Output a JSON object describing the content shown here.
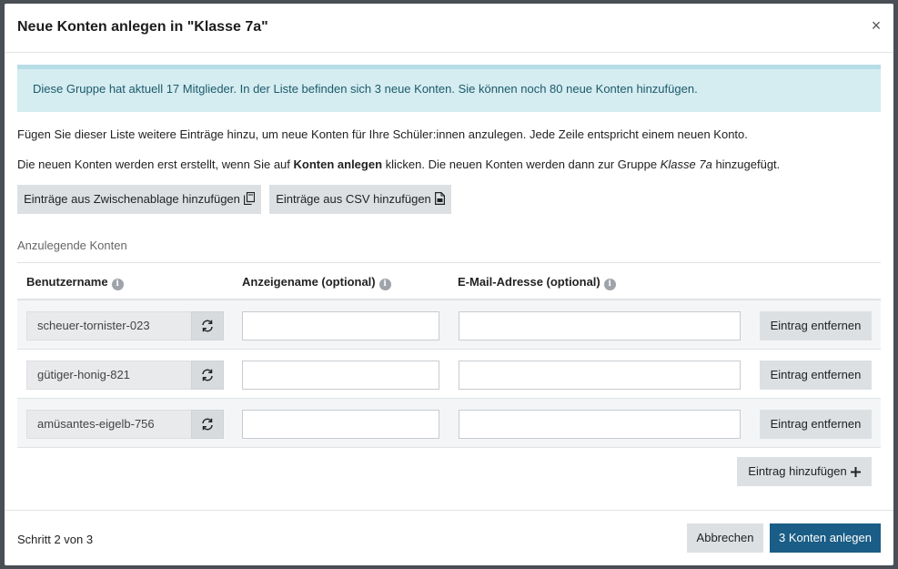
{
  "modal": {
    "title": "Neue Konten anlegen in \"Klasse 7a\"",
    "close_symbol": "×"
  },
  "alert": {
    "text": "Diese Gruppe hat aktuell 17 Mitglieder. In der Liste befinden sich 3 neue Konten. Sie können noch 80 neue Konten hinzufügen."
  },
  "intro": {
    "line1": "Fügen Sie dieser Liste weitere Einträge hinzu, um neue Konten für Ihre Schüler:innen anzulegen. Jede Zeile entspricht einem neuen Konto.",
    "line2_pre": "Die neuen Konten werden erst erstellt, wenn Sie auf ",
    "line2_bold": "Konten anlegen",
    "line2_mid": " klicken. Die neuen Konten werden dann zur Gruppe ",
    "line2_italic": "Klasse 7a",
    "line2_post": " hinzugefügt."
  },
  "import": {
    "clipboard_label": "Einträge aus Zwischenablage hinzufügen",
    "csv_label": "Einträge aus CSV hinzufügen"
  },
  "section_label": "Anzulegende Konten",
  "table": {
    "headers": {
      "username": "Benutzername",
      "display_name": "Anzeigename (optional)",
      "email": "E-Mail-Adresse (optional)"
    },
    "info_glyph": "i",
    "rows": [
      {
        "username": "scheuer-tornister-023",
        "display_name": "",
        "email": "",
        "remove_label": "Eintrag entfernen"
      },
      {
        "username": "gütiger-honig-821",
        "display_name": "",
        "email": "",
        "remove_label": "Eintrag entfernen"
      },
      {
        "username": "amüsantes-eigelb-756",
        "display_name": "",
        "email": "",
        "remove_label": "Eintrag entfernen"
      }
    ],
    "add_entry_label": "Eintrag hinzufügen"
  },
  "footer": {
    "step": "Schritt 2 von 3",
    "cancel_label": "Abbrechen",
    "submit_label": "3 Konten anlegen"
  },
  "colors": {
    "alert_bg": "#d5ecf1",
    "alert_text": "#1b5b6a",
    "primary": "#1a5d86",
    "secondary_btn": "#dde0e3"
  }
}
